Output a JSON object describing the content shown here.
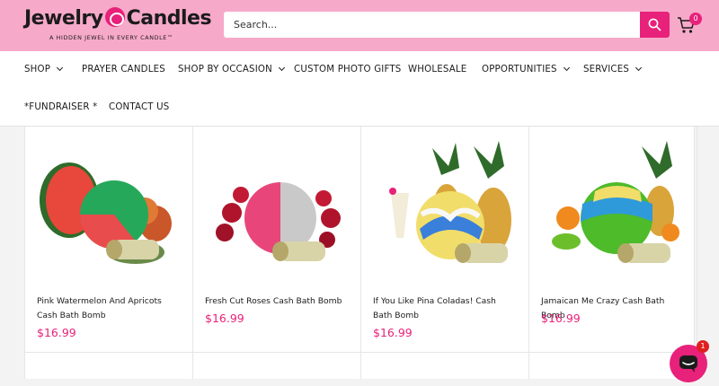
{
  "header": {
    "logo_text_left": "Jewelry",
    "logo_text_right": "Candles",
    "tagline": "A HIDDEN JEWEL IN EVERY CANDLE™",
    "search_placeholder": "Search...",
    "cart_count": "0",
    "brand_color": "#e8217a",
    "header_bg": "#f7a9c9"
  },
  "nav": {
    "items": [
      {
        "label": "SHOP",
        "dropdown": true
      },
      {
        "label": "PRAYER CANDLES",
        "dropdown": false
      },
      {
        "label": "SHOP BY OCCASION",
        "dropdown": true
      },
      {
        "label": "CUSTOM PHOTO GIFTS",
        "dropdown": false
      },
      {
        "label": "WHOLESALE",
        "dropdown": false
      },
      {
        "label": "OPPORTUNITIES",
        "dropdown": true
      },
      {
        "label": "SERVICES",
        "dropdown": true
      },
      {
        "label": "*FUNDRAISER *",
        "dropdown": false
      },
      {
        "label": "CONTACT US",
        "dropdown": false
      }
    ]
  },
  "products": [
    {
      "title": "Pink Watermelon And Apricots Cash Bath Bomb",
      "price": "$16.99",
      "image": "watermelon-bath-bomb-image"
    },
    {
      "title": "Fresh Cut Roses Cash Bath Bomb",
      "price": "$16.99",
      "image": "roses-bath-bomb-image"
    },
    {
      "title": "If You Like Pina Coladas! Cash Bath Bomb",
      "price": "$16.99",
      "image": "pina-colada-bath-bomb-image"
    },
    {
      "title": "Jamaican Me Crazy Cash Bath Bomb",
      "price": "$16.99",
      "image": "jamaican-bath-bomb-image"
    }
  ],
  "chat": {
    "unread": "1",
    "icon": "chat-bubble-icon"
  }
}
